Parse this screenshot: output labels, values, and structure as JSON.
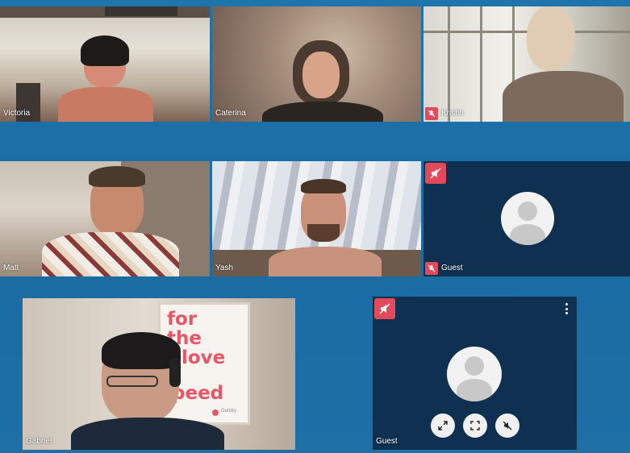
{
  "participants": [
    {
      "name": "Victoria",
      "muted": false
    },
    {
      "name": "Caterina",
      "muted": false
    },
    {
      "name": "Kristin",
      "muted": true
    },
    {
      "name": "Matt",
      "muted": false
    },
    {
      "name": "Yash",
      "muted": false
    },
    {
      "name": "Guest",
      "muted": true,
      "audio_off": true,
      "camera_off": true
    },
    {
      "name": "Gabriel",
      "muted": false
    },
    {
      "name": "Guest",
      "muted": true,
      "audio_off": true,
      "camera_off": true
    }
  ],
  "poster": {
    "lines": [
      "for",
      "the",
      "love",
      "f",
      "peed"
    ],
    "brand": "Gatsby"
  },
  "tile_controls": [
    "fullscreen-button",
    "focus-button",
    "mute-audio-button"
  ],
  "colors": {
    "background": "#1c6fa5",
    "badge": "#e24a5a",
    "guest_tile": "#0f3050",
    "avatar": "#f2f2f2"
  }
}
